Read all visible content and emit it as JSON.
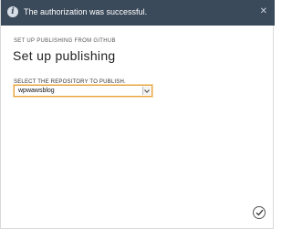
{
  "notification": {
    "message": "The authorization was successful.",
    "icon": "info-icon",
    "close_icon": "close-icon",
    "background_color": "#3b4a5a"
  },
  "dialog": {
    "subtitle": "SET UP PUBLISHING FROM GITHUB",
    "title": "Set up publishing"
  },
  "repository": {
    "label": "SELECT THE REPOSITORY TO PUBLISH.",
    "selected_value": "wpwawsblog",
    "focus_color": "#e5a23a"
  },
  "footer": {
    "done_icon": "checkmark-icon"
  }
}
